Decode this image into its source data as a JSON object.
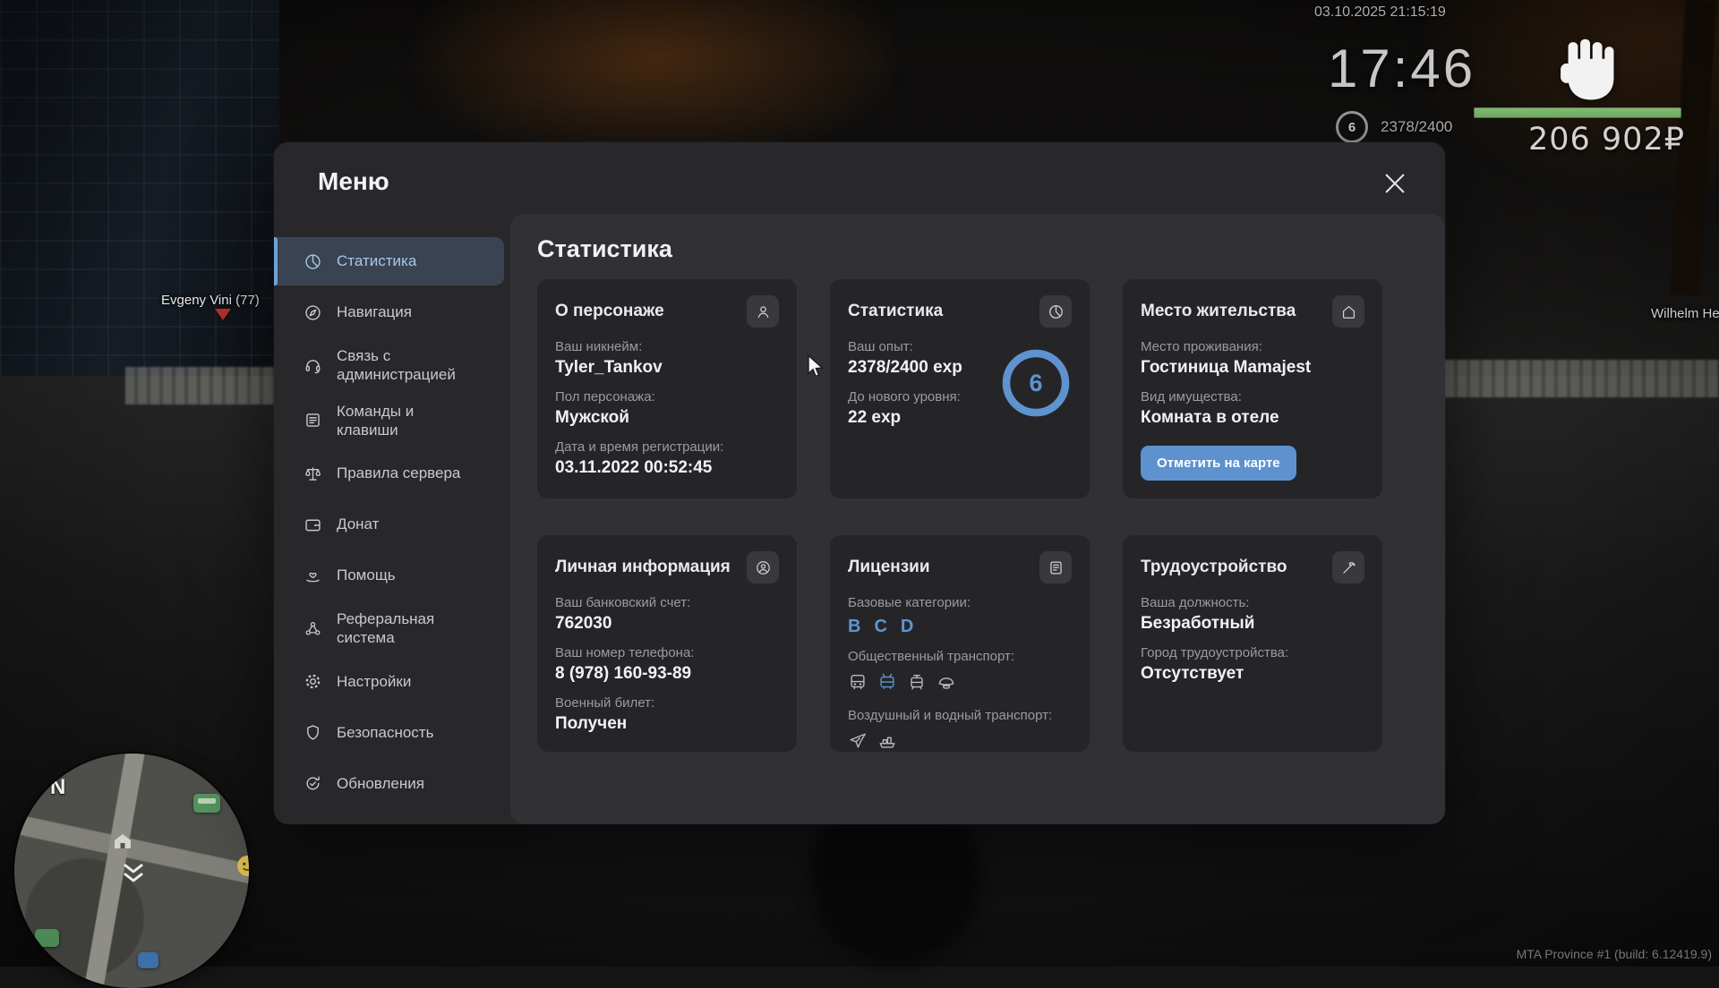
{
  "colors": {
    "accent_blue": "#5e93cf",
    "active_item_bg": "#3a4351",
    "health_green": "#79b36a",
    "panel_bg": "#28282b",
    "content_bg": "#313135",
    "card_bg": "#252528"
  },
  "hud": {
    "datetime": "03.10.2025 21:15:19",
    "clock": "17:46",
    "level": "6",
    "exp": "2378/2400",
    "money": "206 902₽",
    "watermark": "MTA Province #1 (build: 6.12419.9)"
  },
  "world": {
    "nametag_left": "Evgeny Vini (77)",
    "nametag_right": "Wilhelm Henri",
    "minimap_compass": "N"
  },
  "menu": {
    "title": "Меню",
    "heading": "Статистика",
    "sidebar": [
      {
        "label": "Статистика",
        "icon": "pie-chart-icon",
        "active": true
      },
      {
        "label": "Навигация",
        "icon": "compass-icon"
      },
      {
        "label": "Связь с администрацией",
        "icon": "headset-icon"
      },
      {
        "label": "Команды и клавиши",
        "icon": "commands-icon"
      },
      {
        "label": "Правила сервера",
        "icon": "scales-icon"
      },
      {
        "label": "Донат",
        "icon": "wallet-icon"
      },
      {
        "label": "Помощь",
        "icon": "care-icon"
      },
      {
        "label": "Реферальная система",
        "icon": "referral-icon"
      },
      {
        "label": "Настройки",
        "icon": "gear-icon"
      },
      {
        "label": "Безопасность",
        "icon": "shield-icon"
      },
      {
        "label": "Обновления",
        "icon": "updates-icon"
      }
    ],
    "cards": {
      "character": {
        "title": "О персонаже",
        "icon": "person-icon",
        "fields": [
          {
            "label": "Ваш никнейм:",
            "value": "Tyler_Tankov"
          },
          {
            "label": "Пол персонажа:",
            "value": "Мужской"
          },
          {
            "label": "Дата и время регистрации:",
            "value": "03.11.2022 00:52:45"
          }
        ]
      },
      "stats": {
        "title": "Статистика",
        "icon": "pie-chart-icon",
        "fields": [
          {
            "label": "Ваш опыт:",
            "value": "2378/2400 exp"
          },
          {
            "label": "До нового уровня:",
            "value": "22 exp"
          }
        ],
        "level": "6",
        "progress_percent": 99
      },
      "residence": {
        "title": "Место жительства",
        "icon": "home-icon",
        "fields": [
          {
            "label": "Место проживания:",
            "value": "Гостиница Mamajest"
          },
          {
            "label": "Вид имущества:",
            "value": "Комната в отеле"
          }
        ],
        "button_label": "Отметить на карте"
      },
      "personal": {
        "title": "Личная информация",
        "icon": "id-icon",
        "fields": [
          {
            "label": "Ваш банковский счет:",
            "value": "762030"
          },
          {
            "label": "Ваш номер телефона:",
            "value": "8 (978) 160-93-89"
          },
          {
            "label": "Военный билет:",
            "value": "Получен"
          }
        ]
      },
      "licenses": {
        "title": "Лицензии",
        "icon": "license-icon",
        "base_categories_label": "Базовые категории:",
        "base_categories": [
          "B",
          "C",
          "D"
        ],
        "public_transport_label": "Общественный транспорт:",
        "public_transport_icons": [
          "bus-icon",
          "trolleybus-icon",
          "tram-icon",
          "driver-cap-icon"
        ],
        "air_water_label": "Воздушный и водный транспорт:",
        "air_water_icons": [
          "plane-icon",
          "ship-icon"
        ]
      },
      "employment": {
        "title": "Трудоустройство",
        "icon": "tool-icon",
        "fields": [
          {
            "label": "Ваша должность:",
            "value": "Безработный"
          },
          {
            "label": "Город трудоустройства:",
            "value": "Отсутствует"
          }
        ]
      }
    }
  }
}
